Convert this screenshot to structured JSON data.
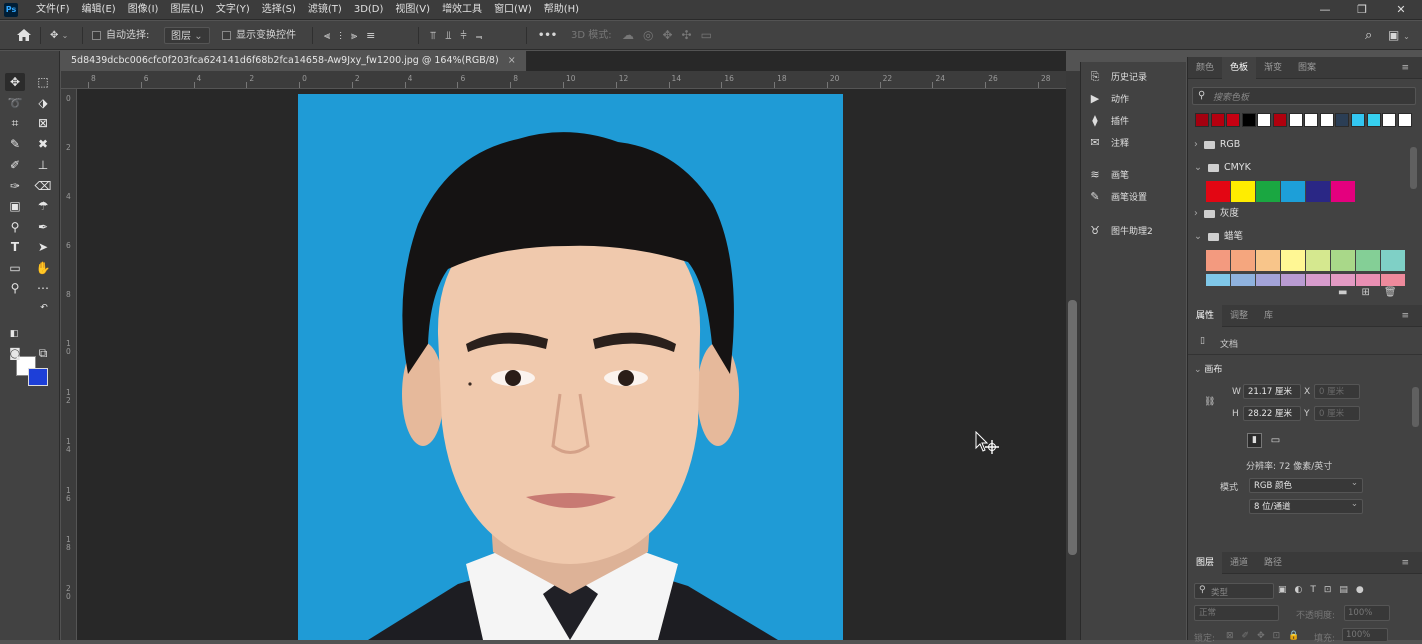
{
  "menubar": {
    "logo": "Ps",
    "items": [
      "文件(F)",
      "编辑(E)",
      "图像(I)",
      "图层(L)",
      "文字(Y)",
      "选择(S)",
      "滤镜(T)",
      "3D(D)",
      "视图(V)",
      "增效工具",
      "窗口(W)",
      "帮助(H)"
    ],
    "minimize": "—",
    "restore": "❐",
    "close": "✕"
  },
  "options": {
    "home_icon": "home-icon",
    "move_icon": "move-icon",
    "auto_select_label": "自动选择:",
    "layer_dropdown": "图层",
    "show_transform_label": "显示变换控件",
    "more": "•••",
    "mode_3d": "3D 模式:"
  },
  "document": {
    "tab_title": "5d8439dcbc006cfc0f203fca624141d6f68b2fca14658-Aw9Jxy_fw1200.jpg @ 164%(RGB/8)",
    "tab_close": "×",
    "ruler_h": [
      "8",
      "6",
      "4",
      "2",
      "0",
      "2",
      "4",
      "6",
      "8",
      "10",
      "12",
      "14",
      "16",
      "18",
      "20",
      "22",
      "24",
      "26",
      "28"
    ],
    "ruler_v": [
      "0",
      "2",
      "4",
      "6",
      "8",
      "1\n0",
      "1\n2",
      "1\n4",
      "1\n6",
      "1\n8",
      "2\n0"
    ]
  },
  "mid_panel": {
    "items": [
      {
        "icon": "history-icon",
        "label": "历史记录"
      },
      {
        "icon": "actions-icon",
        "label": "动作"
      },
      {
        "icon": "plugins-icon",
        "label": "插件"
      },
      {
        "icon": "notes-icon",
        "label": "注释"
      },
      {
        "icon": "brush-icon",
        "label": "画笔"
      },
      {
        "icon": "brush-settings-icon",
        "label": "画笔设置"
      },
      {
        "icon": "assistant-icon",
        "label": "图牛助理2"
      }
    ]
  },
  "swatches_panel": {
    "tabs": [
      "颜色",
      "色板",
      "渐变",
      "图案"
    ],
    "active_tab": "色板",
    "search_placeholder": "搜索色板",
    "recent_colors": [
      "#a4000f",
      "#b5000f",
      "#c80012",
      "#000000",
      "#ffffff",
      "#b0000d",
      "#ffffff",
      "#ffffff",
      "#ffffff",
      "#2b3e55",
      "#33c6f0",
      "#36d0f0",
      "#ffffff",
      "#ffffff"
    ],
    "groups": [
      {
        "name": "RGB",
        "expanded": false
      },
      {
        "name": "CMYK",
        "expanded": true,
        "colors": [
          "#e30613",
          "#ffed00",
          "#1aa741",
          "#1d9fd8",
          "#2a2785",
          "#e4007e"
        ]
      },
      {
        "name": "灰度",
        "expanded": false
      },
      {
        "name": "蜡笔",
        "expanded": true,
        "colors": [
          "#f39a7f",
          "#f5a67e",
          "#f8c58a",
          "#fff794",
          "#d5e88f",
          "#a9d889",
          "#84cf96",
          "#7fd0c6"
        ]
      }
    ]
  },
  "properties_panel": {
    "tabs": [
      "属性",
      "调整",
      "库"
    ],
    "active_tab": "属性",
    "doc_label": "文档",
    "section": "画布",
    "w_label": "W",
    "w_value": "21.17 厘米",
    "h_label": "H",
    "h_value": "28.22 厘米",
    "x_label": "X",
    "x_value": "0 厘米",
    "y_label": "Y",
    "y_value": "0 厘米",
    "resolution": "分辨率: 72 像素/英寸",
    "mode_label": "模式",
    "mode_value": "RGB 颜色",
    "depth_value": "8 位/通道"
  },
  "layers_panel": {
    "tabs": [
      "图层",
      "通道",
      "路径"
    ],
    "active_tab": "图层",
    "kind_placeholder": "类型",
    "blend_mode": "正常",
    "opacity_label": "不透明度:",
    "opacity_value": "100%",
    "lock_label": "锁定:",
    "fill_label": "填充:",
    "fill_value": "100%"
  }
}
